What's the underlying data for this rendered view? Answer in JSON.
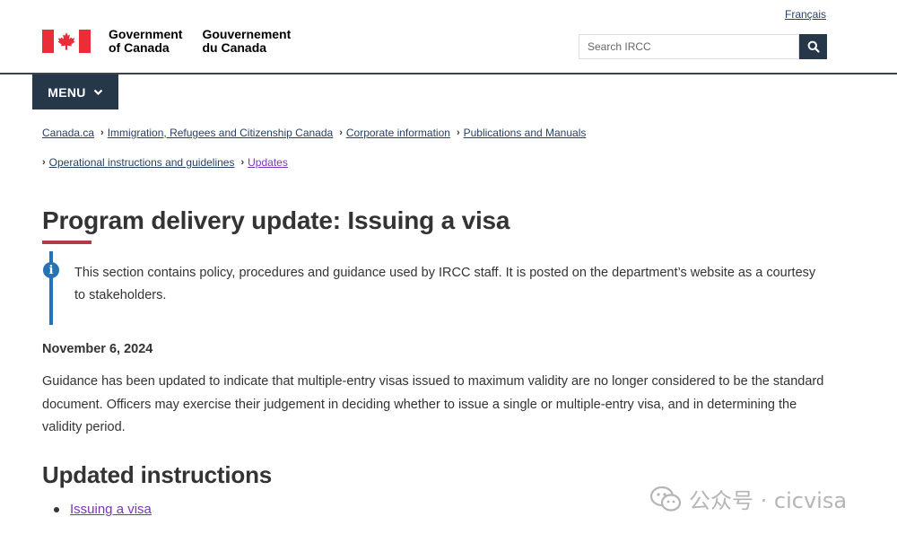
{
  "header": {
    "language_link": "Français",
    "signature": {
      "en_line1": "Government",
      "en_line2": "of Canada",
      "fr_line1": "Gouvernement",
      "fr_line2": "du Canada"
    },
    "search": {
      "placeholder": "Search IRCC",
      "icon": "search-icon"
    },
    "menu_label": "MENU"
  },
  "breadcrumbs": {
    "row1": [
      "Canada.ca",
      "Immigration, Refugees and Citizenship Canada",
      "Corporate information",
      "Publications and Manuals"
    ],
    "row2": [
      "Operational instructions and guidelines",
      "Updates"
    ]
  },
  "page": {
    "title": "Program delivery update: Issuing a visa",
    "notice": "This section contains policy, procedures and guidance used by IRCC staff. It is posted on the department’s website as a courtesy to stakeholders.",
    "date": "November 6, 2024",
    "paragraph": "Guidance has been updated to indicate that multiple-entry visas issued to maximum validity are no longer considered to be the standard document. Officers may exercise their judgement in deciding whether to issue a single or multiple-entry visa, and in determining the validity period.",
    "section_heading": "Updated instructions",
    "links": [
      "Issuing a visa"
    ]
  },
  "watermark": {
    "text": "公众号 · cicvisa"
  },
  "colors": {
    "navy": "#26374a",
    "link": "#284162",
    "visited": "#7834bc",
    "accent_red": "#af3c43",
    "info_blue": "#2572b4",
    "flag_red": "#eb2d37"
  }
}
